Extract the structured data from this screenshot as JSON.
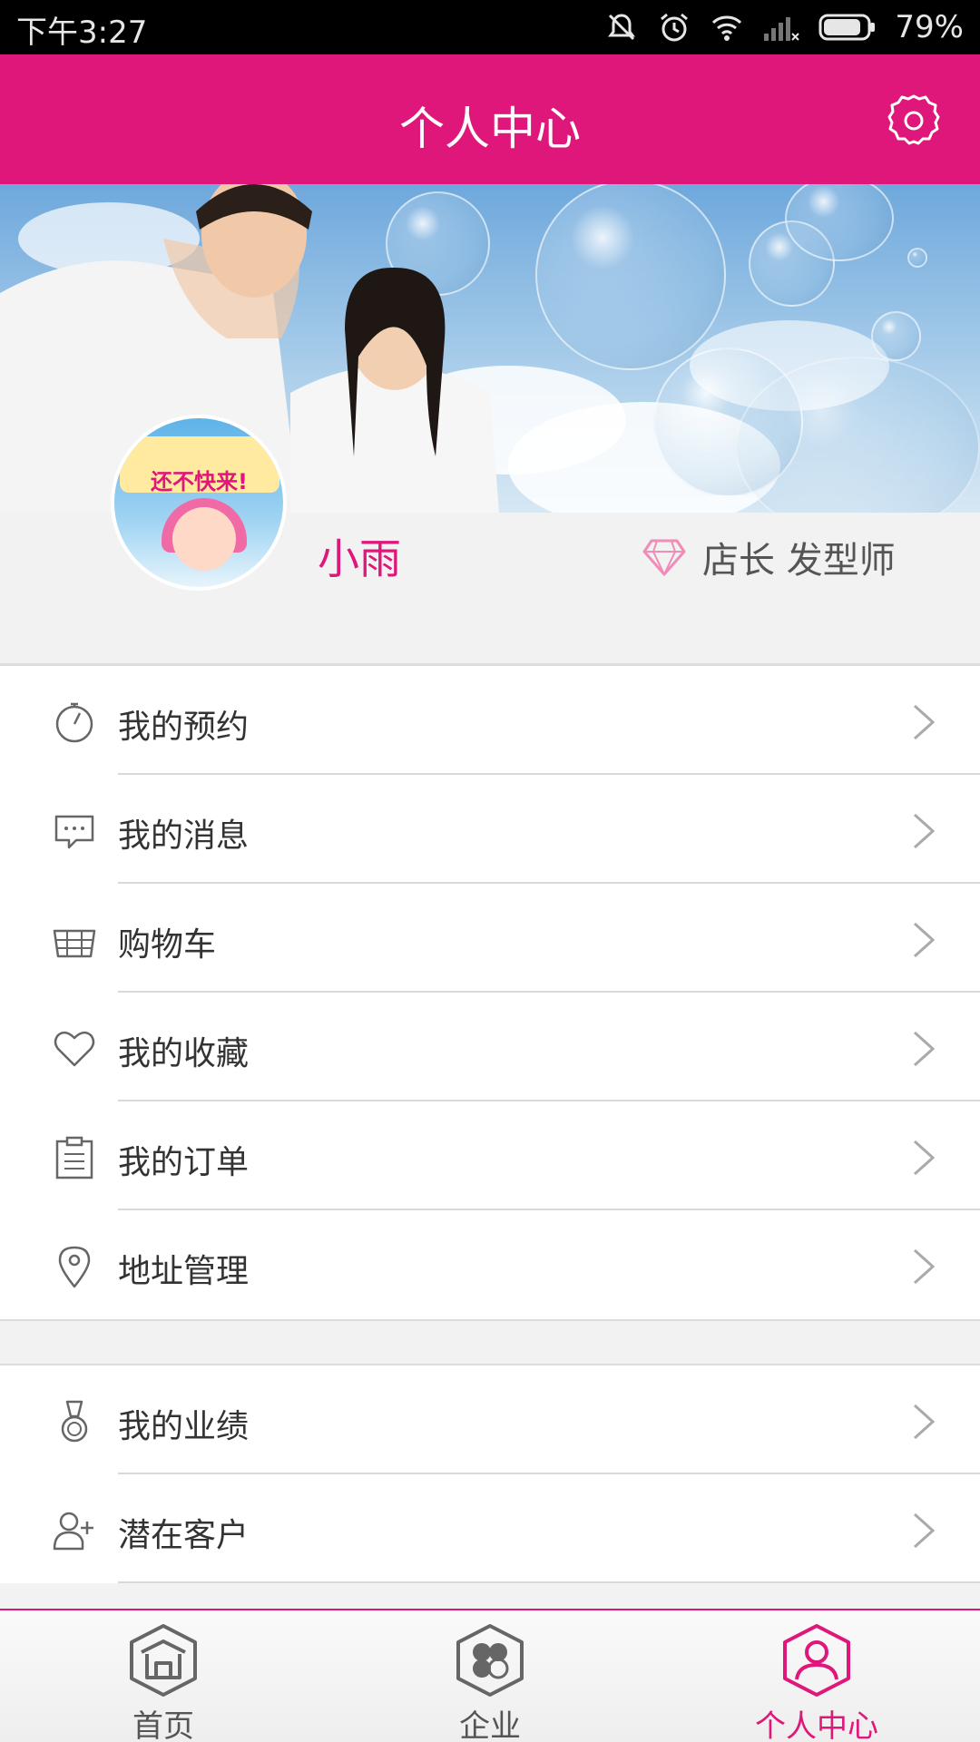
{
  "status_bar": {
    "time": "下午3:27",
    "battery": "79%"
  },
  "header": {
    "title": "个人中心",
    "settings_icon": "gear-icon"
  },
  "profile": {
    "username": "小雨",
    "role": "店长 发型师",
    "role_icon": "diamond-icon",
    "avatar_text": "还不快来!"
  },
  "menu_group_1": [
    {
      "label": "我的预约",
      "icon": "stopwatch-icon"
    },
    {
      "label": "我的消息",
      "icon": "message-icon"
    },
    {
      "label": "购物车",
      "icon": "basket-icon"
    },
    {
      "label": "我的收藏",
      "icon": "heart-icon"
    },
    {
      "label": "我的订单",
      "icon": "clipboard-icon"
    },
    {
      "label": "地址管理",
      "icon": "location-pin-icon"
    }
  ],
  "menu_group_2": [
    {
      "label": "我的业绩",
      "icon": "medal-icon"
    },
    {
      "label": "潜在客户",
      "icon": "add-user-icon"
    }
  ],
  "tab_bar": [
    {
      "label": "首页",
      "icon": "home-icon",
      "active": false
    },
    {
      "label": "企业",
      "icon": "clover-icon",
      "active": false
    },
    {
      "label": "个人中心",
      "icon": "person-icon",
      "active": true
    }
  ],
  "colors": {
    "brand": "#e0177a",
    "text": "#333333",
    "separator": "#d9d9d9"
  }
}
